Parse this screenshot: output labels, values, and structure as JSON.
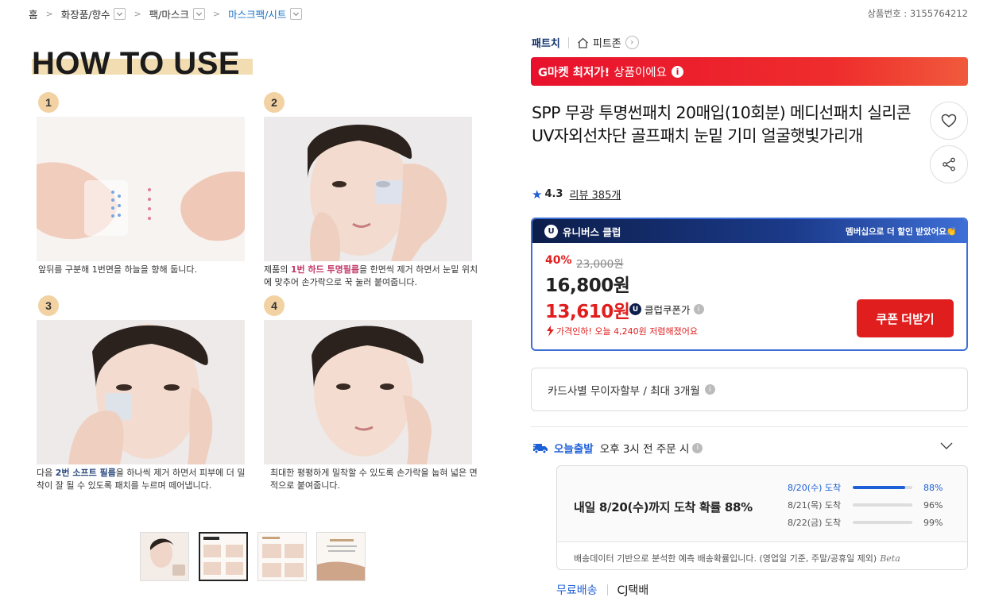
{
  "breadcrumb": {
    "items": [
      "홈",
      "화장품/향수",
      "팩/마스크",
      "마스크팩/시트"
    ]
  },
  "product_number": "상품번호 : 3155764212",
  "gallery": {
    "title": "HOW TO USE",
    "steps": [
      {
        "num": "1",
        "caption_plain": "앞뒤를 구분해 1번면을 하늘을 향해 둡니다."
      },
      {
        "num": "2",
        "caption_pre": "제품의 ",
        "caption_hl": "1번 하드 투명필름",
        "caption_post": "을 한면씩 제거 하면서 눈밑 위치에 맞추어 손가락으로 꾹 눌러 붙여줍니다."
      },
      {
        "num": "3",
        "caption_pre": "다음 ",
        "caption_hl": "2번 소프트 필름",
        "caption_post": "을 하나씩 제거 하면서 피부에 더 밀착이 잘 될 수 있도록 패치를 누르며 떼어냅니다."
      },
      {
        "num": "4",
        "caption_plain": "최대한 평평하게 밀착할 수 있도록 손가락을 눕혀 넓은 면적으로 붙여줍니다."
      }
    ],
    "selected_thumb": 2
  },
  "seller": {
    "name": "패트치",
    "zone": "피트존"
  },
  "promo_banner": {
    "bold": "G마켓 최저가!",
    "rest": "상품이에요"
  },
  "product_title": "SPP 무광 투명썬패치 20매입(10회분) 메디선패치 실리콘 UV자외선차단 골프패치 눈밑 기미 얼굴햇빛가리개",
  "rating": {
    "score": "4.3",
    "reviews": "리뷰 385개"
  },
  "universe_club": {
    "label": "유니버스 클럽",
    "promo": "멤버십으로 더 할인 받았어요👏",
    "discount": "40%",
    "original_price": "23,000원",
    "price": "16,800원",
    "coupon_price": "13,610원",
    "coupon_label": "클럽쿠폰가",
    "price_drop": "가격인하! 오늘 4,240원 저렴해졌어요",
    "coupon_button": "쿠폰 더받기"
  },
  "installment": "카드사별 무이자할부 / 최대 3개월",
  "shipping": {
    "today_label": "오늘출발",
    "cutoff": "오후 3시 전 주문 시",
    "headline": "내일 8/20(수)까지 도착 확률 88%",
    "rows": [
      {
        "label": "8/20(수) 도착",
        "pct": "88%",
        "value": 0.88
      },
      {
        "label": "8/21(목) 도착",
        "pct": "96%",
        "value": 0.96
      },
      {
        "label": "8/22(금) 도착",
        "pct": "99%",
        "value": 0.99
      }
    ],
    "note": "배송데이터 기반으로 분석한 예측 배송확률입니다. (영업일 기준, 주말/공휴일 제외)",
    "beta": "Beta",
    "free": "무료배송",
    "courier": "CJ택배"
  },
  "colors": {
    "accent_red": "#e01e1e",
    "accent_blue": "#1d5fd6",
    "club_navy": "#0c1e4a"
  }
}
